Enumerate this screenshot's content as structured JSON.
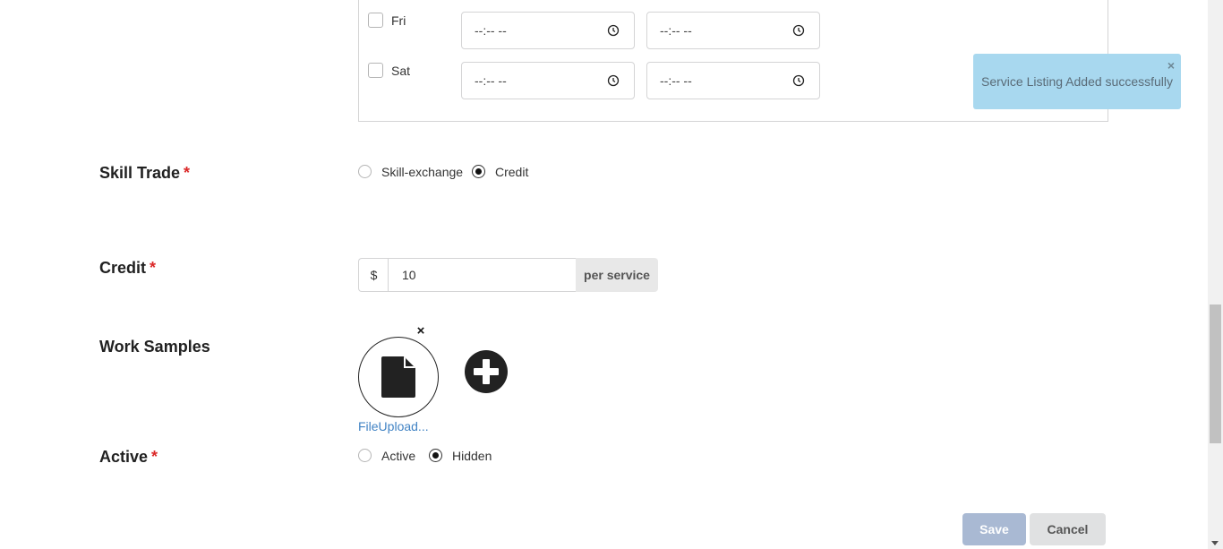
{
  "availability": {
    "days": [
      {
        "label": "Fri",
        "checked": false,
        "start": "--:-- --",
        "end": "--:-- --"
      },
      {
        "label": "Sat",
        "checked": false,
        "start": "--:-- --",
        "end": "--:-- --"
      }
    ]
  },
  "skill_trade": {
    "label": "Skill Trade",
    "required_mark": "*",
    "options": [
      {
        "label": "Skill-exchange",
        "checked": false
      },
      {
        "label": "Credit",
        "checked": true
      }
    ]
  },
  "credit": {
    "label": "Credit",
    "required_mark": "*",
    "currency_symbol": "$",
    "value": "10",
    "suffix": "per service"
  },
  "work_samples": {
    "label": "Work Samples",
    "remove_icon": "close-icon",
    "file_icon": "file-icon",
    "add_icon": "plus-circle-icon",
    "file_name": "FileUpload..."
  },
  "active": {
    "label": "Active",
    "required_mark": "*",
    "options": [
      {
        "label": "Active",
        "checked": false
      },
      {
        "label": "Hidden",
        "checked": true
      }
    ]
  },
  "buttons": {
    "save": "Save",
    "cancel": "Cancel"
  },
  "toast": {
    "message": "Service Listing Added successfully",
    "close": "×"
  },
  "colors": {
    "required": "#db2828",
    "link": "#4183c4",
    "toast_bg": "#a8d8ef",
    "save_disabled": "#a9b9d3"
  }
}
